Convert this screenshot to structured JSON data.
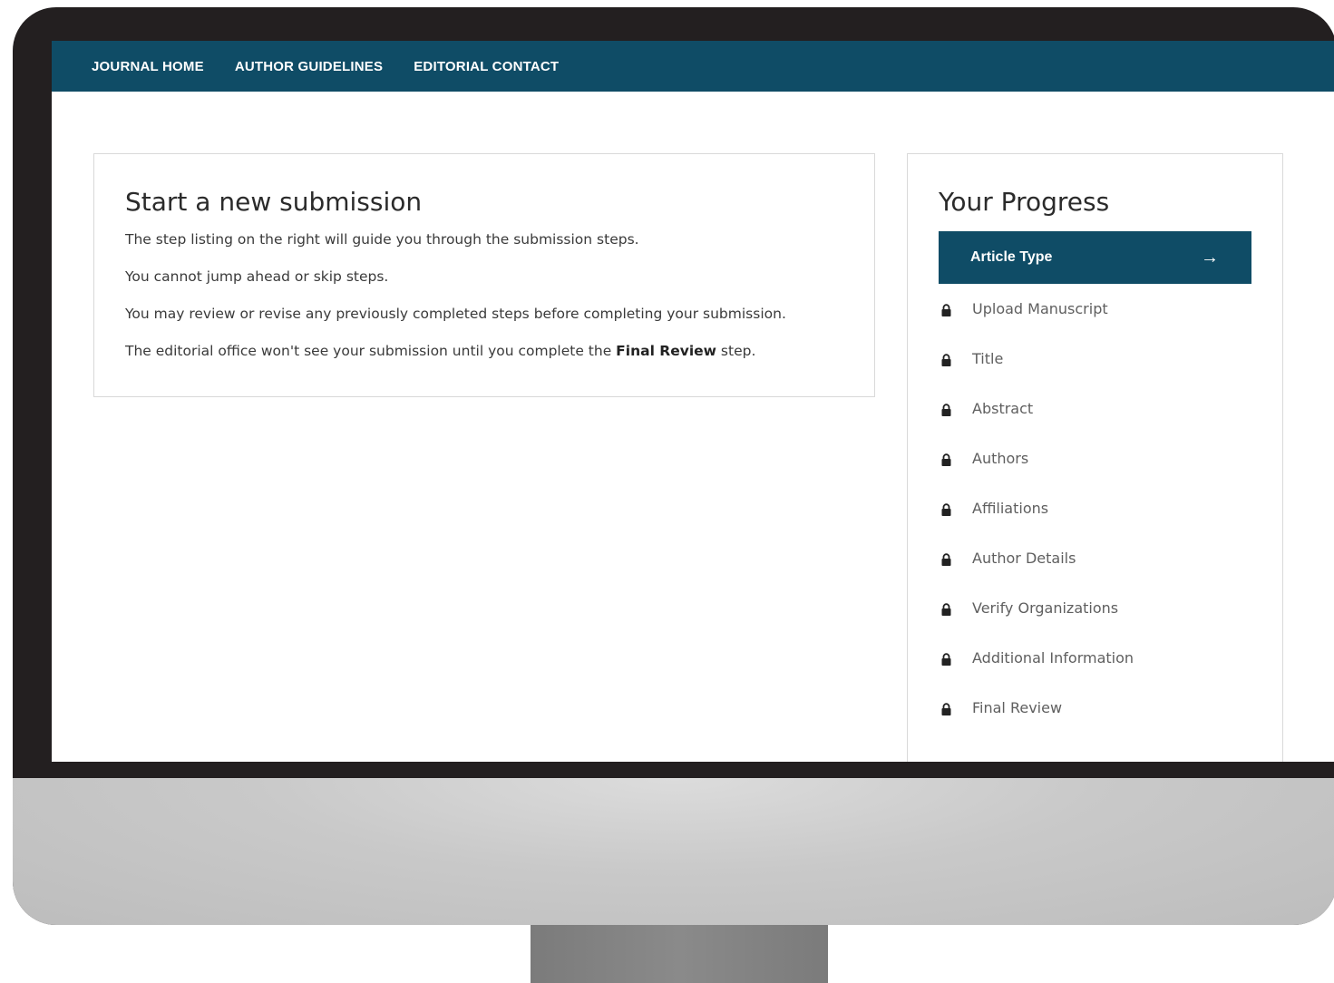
{
  "nav": {
    "items": [
      {
        "label": "JOURNAL HOME"
      },
      {
        "label": "AUTHOR GUIDELINES"
      },
      {
        "label": "EDITORIAL CONTACT"
      }
    ]
  },
  "intro": {
    "title": "Start a new submission",
    "lines": [
      "The step listing on the right will guide you through the submission steps.",
      "You cannot jump ahead or skip steps.",
      "You may review or revise any previously completed steps before completing your submission."
    ],
    "last_line_prefix": "The editorial office won't see your submission until you complete the ",
    "last_line_bold": "Final Review",
    "last_line_suffix": " step."
  },
  "progress": {
    "title": "Your Progress",
    "active_step": "Article Type",
    "active_icon": "arrow-right-icon",
    "locked_icon": "lock-icon",
    "steps": [
      "Upload Manuscript",
      "Title",
      "Abstract",
      "Authors",
      "Affiliations",
      "Author Details",
      "Verify Organizations",
      "Additional Information",
      "Final Review"
    ]
  },
  "colors": {
    "brand": "#0f4c66",
    "frame": "#231f20"
  }
}
